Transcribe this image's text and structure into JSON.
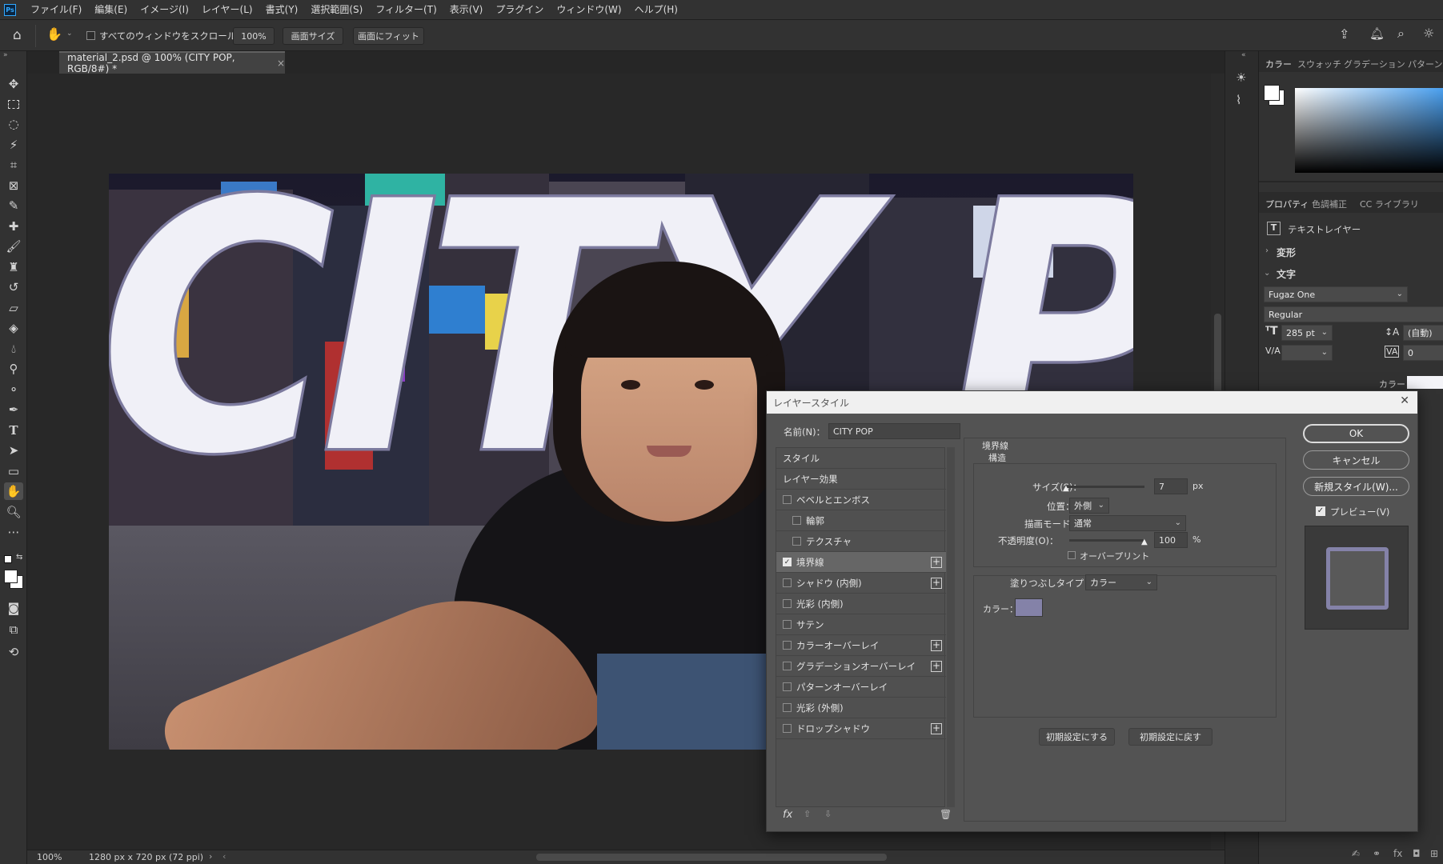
{
  "menubar": {
    "logo": "Ps",
    "items": [
      "ファイル(F)",
      "編集(E)",
      "イメージ(I)",
      "レイヤー(L)",
      "書式(Y)",
      "選択範囲(S)",
      "フィルター(T)",
      "表示(V)",
      "プラグイン",
      "ウィンドウ(W)",
      "ヘルプ(H)"
    ]
  },
  "options": {
    "scroll_all_label": "すべてのウィンドウをスクロール",
    "zoom_value": "100%",
    "screen_size_label": "画面サイズ",
    "fit_screen_label": "画面にフィット"
  },
  "document": {
    "tab_title": "material_2.psd @ 100% (CITY POP, RGB/8#) *",
    "close_glyph": "×",
    "canvas_text": "CITY POP"
  },
  "status": {
    "zoom": "100%",
    "doc_info": "1280 px x 720 px (72 ppi)"
  },
  "color_panel": {
    "tabs": [
      "カラー",
      "スウォッチ",
      "グラデーション",
      "パターン"
    ],
    "colors": {
      "foreground": "#ffffff",
      "background": "#ffffff",
      "spectrum_top": "#4aa0f0"
    }
  },
  "properties_panel": {
    "tabs": [
      "プロパティ",
      "色調補正",
      "CC ライブラリ"
    ],
    "layer_type": "テキストレイヤー",
    "transform_label": "変形",
    "character_label": "文字",
    "font_family": "Fugaz One",
    "font_style": "Regular",
    "font_size": "285 pt",
    "leading": "(自動)",
    "tracking": "0",
    "color_label": "カラー"
  },
  "dialog": {
    "title": "レイヤースタイル",
    "close_glyph": "✕",
    "name_label": "名前(N)：",
    "name_value": "CITY POP",
    "styles": [
      {
        "label": "スタイル",
        "checkbox": false,
        "checked": false,
        "plus": false,
        "indent": 0,
        "selected": false
      },
      {
        "label": "レイヤー効果",
        "checkbox": false,
        "checked": false,
        "plus": false,
        "indent": 0,
        "selected": false
      },
      {
        "label": "ベベルとエンボス",
        "checkbox": true,
        "checked": false,
        "plus": false,
        "indent": 0,
        "selected": false
      },
      {
        "label": "輪郭",
        "checkbox": true,
        "checked": false,
        "plus": false,
        "indent": 1,
        "selected": false
      },
      {
        "label": "テクスチャ",
        "checkbox": true,
        "checked": false,
        "plus": false,
        "indent": 1,
        "selected": false
      },
      {
        "label": "境界線",
        "checkbox": true,
        "checked": true,
        "plus": true,
        "indent": 0,
        "selected": true
      },
      {
        "label": "シャドウ (内側)",
        "checkbox": true,
        "checked": false,
        "plus": true,
        "indent": 0,
        "selected": false
      },
      {
        "label": "光彩 (内側)",
        "checkbox": true,
        "checked": false,
        "plus": false,
        "indent": 0,
        "selected": false
      },
      {
        "label": "サテン",
        "checkbox": true,
        "checked": false,
        "plus": false,
        "indent": 0,
        "selected": false
      },
      {
        "label": "カラーオーバーレイ",
        "checkbox": true,
        "checked": false,
        "plus": true,
        "indent": 0,
        "selected": false
      },
      {
        "label": "グラデーションオーバーレイ",
        "checkbox": true,
        "checked": false,
        "plus": true,
        "indent": 0,
        "selected": false
      },
      {
        "label": "パターンオーバーレイ",
        "checkbox": true,
        "checked": false,
        "plus": false,
        "indent": 0,
        "selected": false
      },
      {
        "label": "光彩 (外側)",
        "checkbox": true,
        "checked": false,
        "plus": false,
        "indent": 0,
        "selected": false
      },
      {
        "label": "ドロップシャドウ",
        "checkbox": true,
        "checked": false,
        "plus": true,
        "indent": 0,
        "selected": false
      }
    ],
    "stroke": {
      "section_title": "境界線",
      "structure_title": "構造",
      "size_label": "サイズ(S)：",
      "size_value": "7",
      "size_unit": "px",
      "size_slider_fraction": 0.02,
      "position_label": "位置：",
      "position_value": "外側",
      "blend_label": "描画モード：",
      "blend_value": "通常",
      "opacity_label": "不透明度(O)：",
      "opacity_value": "100",
      "opacity_unit": "%",
      "opacity_slider_fraction": 1.0,
      "overprint_label": "オーバープリント",
      "fill_type_label": "塗りつぶしタイプ：",
      "fill_type_value": "カラー",
      "color_label": "カラー：",
      "color_value": "#8482a8"
    },
    "make_default_label": "初期設定にする",
    "reset_default_label": "初期設定に戻す",
    "ok_label": "OK",
    "cancel_label": "キャンセル",
    "new_style_label": "新規スタイル(W)...",
    "preview_label": "プレビュー(V)",
    "fx_label": "fx"
  }
}
